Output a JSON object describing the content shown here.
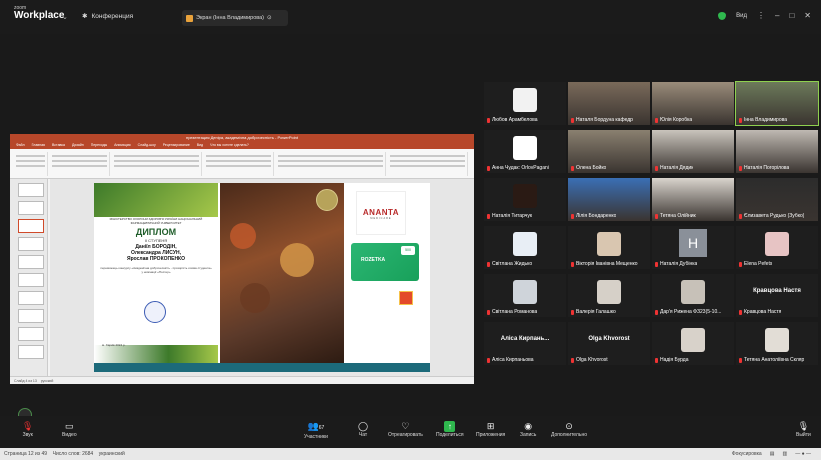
{
  "topbar": {
    "logo_small": "zoom",
    "logo_big": "Workplace",
    "conference_label": "Конференция",
    "share_label": "Экран (Інна Владимирова)",
    "view_label": "Вид"
  },
  "ppt": {
    "title": "презентация Деніра, академічна доброчесність - PowerPoint",
    "menu": [
      "Файл",
      "Главная",
      "Вставка",
      "Дизайн",
      "Переходы",
      "Анимация",
      "Слайд-шоу",
      "Рецензирование",
      "Вид",
      "Что вы хотите сделать?"
    ],
    "status_left": "Слайд 4 из 13",
    "status_lang": "русский"
  },
  "slide": {
    "dip_heading": "МІНІСТЕРСТВО ОХОРОНИ ЗДОРОВ'Я УКРАЇНИ НАЦІОНАЛЬНИЙ ФАРМАЦЕВТИЧНИЙ УНІВЕРСИТЕТ",
    "dip_word": "ДИПЛОМ",
    "dip_sub": "ІІ СТУПЕНЯ",
    "dip_names": [
      "Даніїл БОРОДІН,",
      "Олександра ЛИСУН,",
      "Ярослав ПРОКОПЕНКО"
    ],
    "dip_body": "переможець конкурсу «Академічна доброчесність - прозорість очима студента» у номінації «Постер»",
    "dip_date": "м. Харків 2024 р.",
    "ananta_logo": "ANANTA",
    "ananta_sub": "MEDICARE",
    "rozetka": "ROZETKA",
    "rozetka_badge": "500"
  },
  "participants": [
    {
      "name": "Любов Арамбелова",
      "kind": "avatar",
      "bg": "#f2f2f2"
    },
    {
      "name": "Наталя Бордуна кафедр",
      "kind": "video",
      "bg": "#7a6a5a"
    },
    {
      "name": "Юлія Коробка",
      "kind": "video",
      "bg": "#9a8c7a"
    },
    {
      "name": "Інна Владимирова",
      "kind": "video",
      "bg": "#6c7a5a",
      "active": true
    },
    {
      "name": "Анна Чудак: OrlovPagani",
      "kind": "avatar",
      "bg": "#ffffff"
    },
    {
      "name": "Олена Бойко",
      "kind": "video",
      "bg": "#8a8070"
    },
    {
      "name": "Наталія Дядик",
      "kind": "video",
      "bg": "#c9c4bc"
    },
    {
      "name": "Наталія Погорілова",
      "kind": "video",
      "bg": "#bfb9b2"
    },
    {
      "name": "Наталія Титарчук",
      "kind": "avatar",
      "bg": "#2a1a14"
    },
    {
      "name": "Лілія Бондаренко",
      "kind": "video",
      "bg": "#3a6fb5"
    },
    {
      "name": "Тетяна Олійник",
      "kind": "video",
      "bg": "#d9d4cd"
    },
    {
      "name": "Єлизавета Рудько (Зубко)",
      "kind": "video",
      "bg": "#2c2c2c"
    },
    {
      "name": "Світлана Жидько",
      "kind": "avatar",
      "bg": "#e8eef5"
    },
    {
      "name": "Вікторія Іванівна Мещенко",
      "kind": "avatar",
      "bg": "#d9c6b0"
    },
    {
      "name": "Наталія Дубінка",
      "kind": "letter",
      "bg": "#8a9099",
      "letter": "H"
    },
    {
      "name": "Elena Pefets",
      "kind": "avatar",
      "bg": "#e7c4c4"
    },
    {
      "name": "Світлана Романова",
      "kind": "avatar",
      "bg": "#cfd4da"
    },
    {
      "name": "Валерія Галашко",
      "kind": "avatar",
      "bg": "#d6d0c8"
    },
    {
      "name": "Дар'я Рижена ФЗ23(5-10...",
      "kind": "avatar",
      "bg": "#c7c1b8"
    },
    {
      "name": "Кравцова Настя",
      "kind": "bigname",
      "big": "Кравцова Настя"
    },
    {
      "name": "Аліса Кирпаньова",
      "kind": "bigname",
      "big": "Аліса Кирпань..."
    },
    {
      "name": "Olga Khvorost",
      "kind": "bigname",
      "big": "Olga Khvorost"
    },
    {
      "name": "Надія Бурда",
      "kind": "avatar",
      "bg": "#d8d2ca"
    },
    {
      "name": "Тетяна Анатоліївна Скляр",
      "kind": "avatar",
      "bg": "#e2ddd6"
    }
  ],
  "toolbar": {
    "audio": "Звук",
    "video": "Видео",
    "participants": "Участники",
    "participants_count": "67",
    "chat": "Чат",
    "react": "Отреагировать",
    "share": "Поделиться",
    "apps": "Приложения",
    "record": "Запись",
    "more": "Дополнительно",
    "leave": "Выйти"
  },
  "statusbar": {
    "page": "Страница 12 из 49",
    "words": "Число слов: 2684",
    "lang": "украинский",
    "focus": "Фокусировка"
  }
}
